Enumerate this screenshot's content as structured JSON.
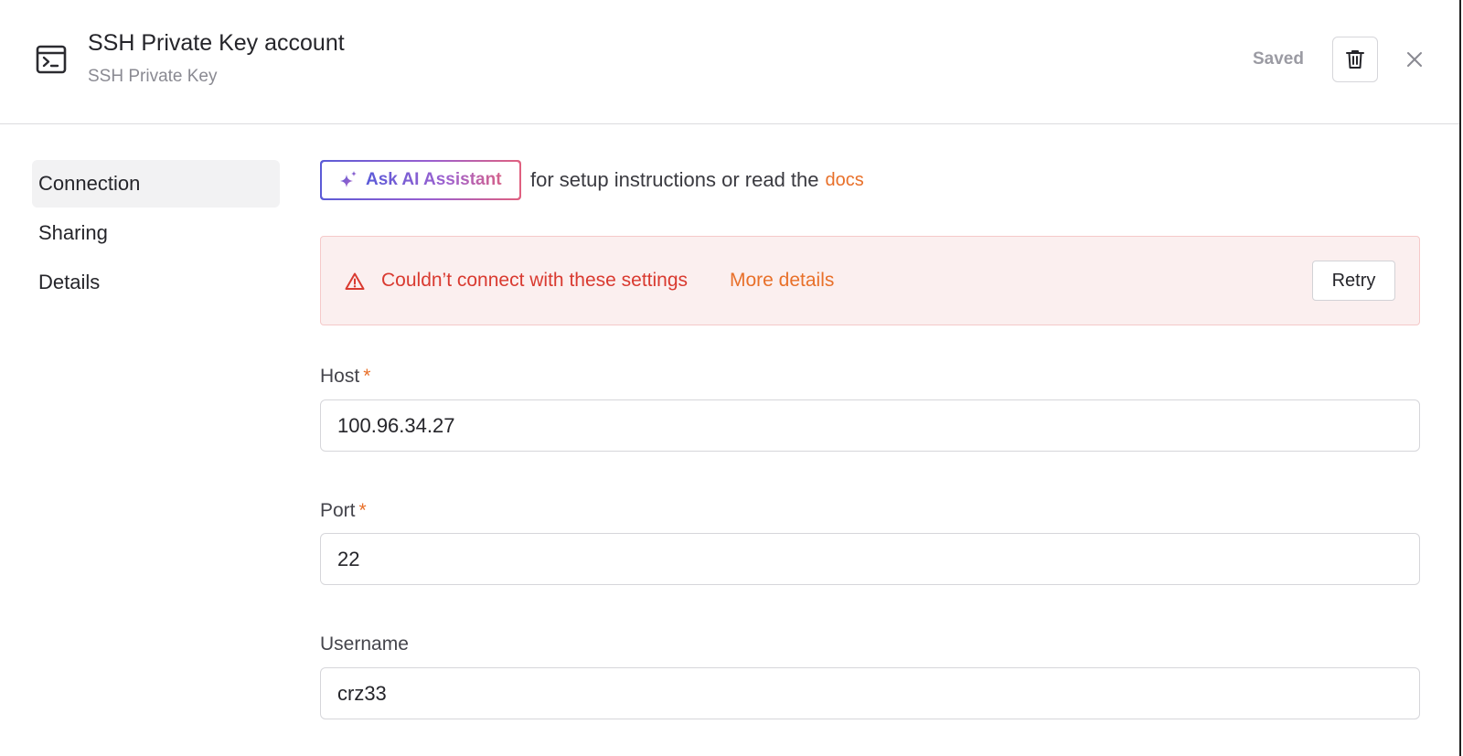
{
  "header": {
    "icon": "terminal-icon",
    "title": "SSH Private Key account",
    "subtitle": "SSH Private Key",
    "status_label": "Saved",
    "delete_icon": "trash-icon",
    "close_icon": "close-icon"
  },
  "sidebar": {
    "items": [
      {
        "label": "Connection",
        "active": true
      },
      {
        "label": "Sharing",
        "active": false
      },
      {
        "label": "Details",
        "active": false
      }
    ]
  },
  "assistant": {
    "icon": "sparkle-icon",
    "button_label": "Ask AI Assistant",
    "text": "for setup instructions or read the",
    "docs_link": "docs"
  },
  "error": {
    "icon": "warning-icon",
    "message": "Couldn’t connect with these settings",
    "details_link": "More details",
    "retry_label": "Retry"
  },
  "form": {
    "host": {
      "label": "Host",
      "required_mark": "*",
      "value": "100.96.34.27"
    },
    "port": {
      "label": "Port",
      "required_mark": "*",
      "value": "22"
    },
    "username": {
      "label": "Username",
      "value": "crz33"
    }
  },
  "colors": {
    "accent": "#e8702a",
    "error": "#d93a30",
    "error_bg": "#fbefef",
    "ai_gradient_start": "#5b5bd6",
    "ai_gradient_end": "#e0607f"
  }
}
